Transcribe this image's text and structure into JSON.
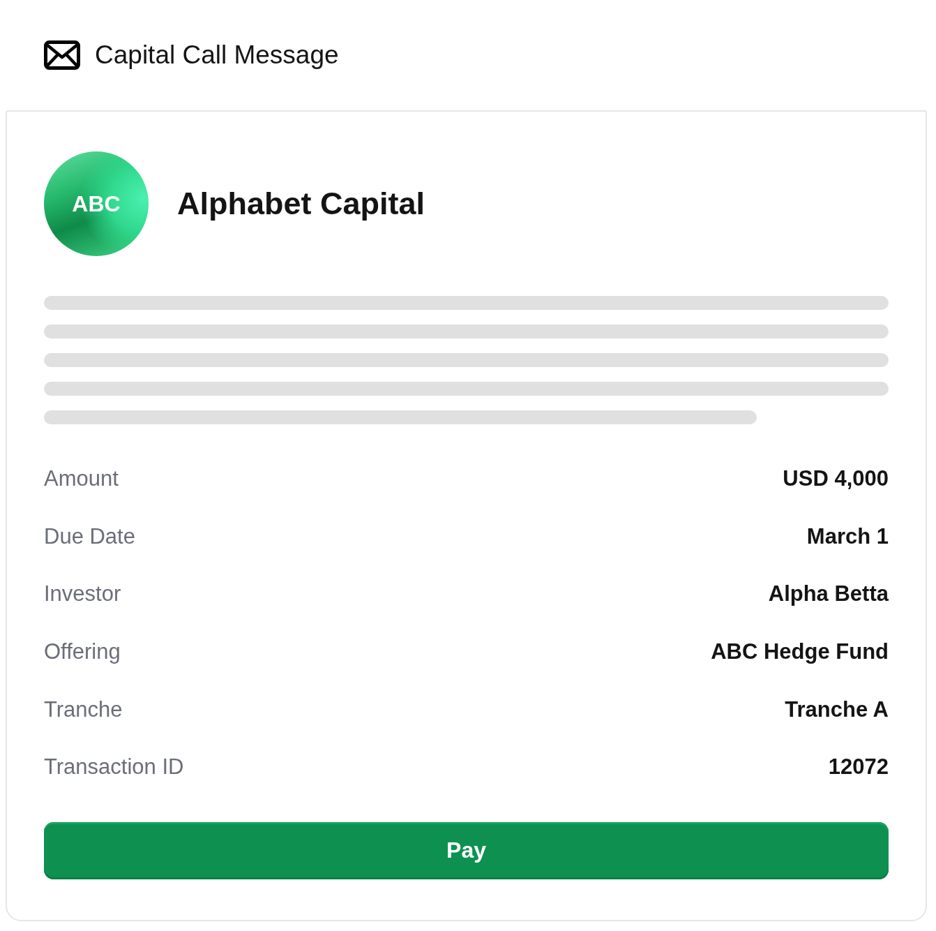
{
  "header": {
    "title": "Capital Call Message"
  },
  "sender": {
    "initials": "ABC",
    "name": "Alphabet Capital"
  },
  "details": [
    {
      "label": "Amount",
      "value": "USD 4,000"
    },
    {
      "label": "Due Date",
      "value": "March 1"
    },
    {
      "label": "Investor",
      "value": "Alpha Betta"
    },
    {
      "label": "Offering",
      "value": "ABC Hedge Fund"
    },
    {
      "label": "Tranche",
      "value": "Tranche A"
    },
    {
      "label": "Transaction ID",
      "value": "12072"
    }
  ],
  "button": {
    "label": "Pay"
  }
}
